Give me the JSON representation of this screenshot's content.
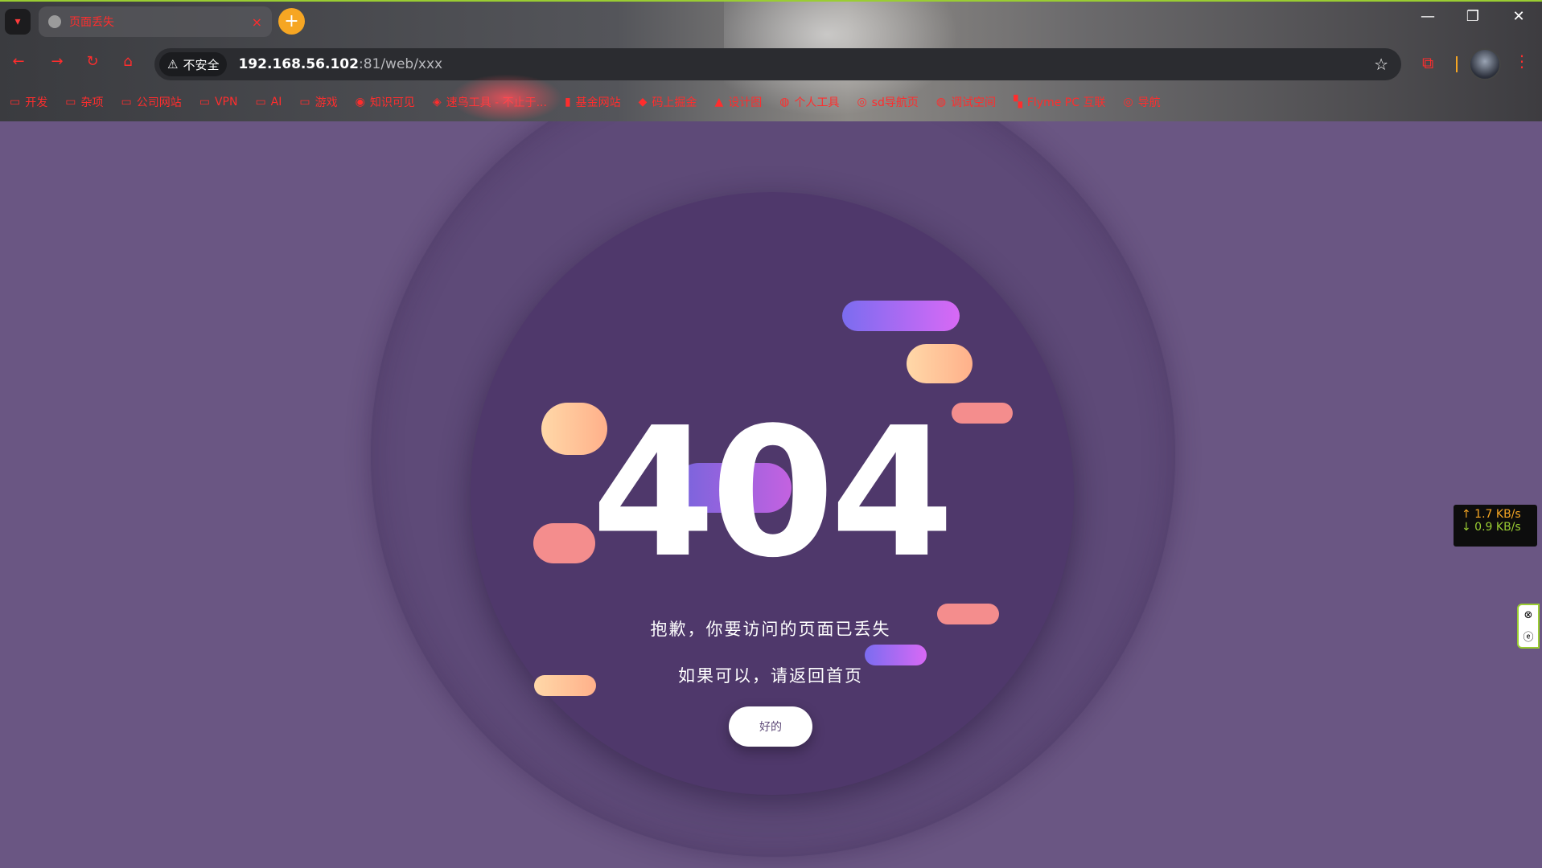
{
  "browser": {
    "tab": {
      "title": "页面丢失",
      "close_glyph": "×"
    },
    "new_tab_glyph": "+",
    "window_controls": {
      "minimize": "—",
      "restore": "❐",
      "close": "✕"
    },
    "nav": {
      "back": "←",
      "forward": "→",
      "reload": "↻",
      "home": "⌂"
    },
    "omnibox": {
      "security_label": "不安全",
      "warn_glyph": "⚠",
      "url_host": "192.168.56.102",
      "url_path": ":81/web/xxx"
    },
    "bookmarks": [
      {
        "icon": "folder-icon",
        "glyph": "▭",
        "label": "开发"
      },
      {
        "icon": "folder-icon",
        "glyph": "▭",
        "label": "杂项"
      },
      {
        "icon": "folder-icon",
        "glyph": "▭",
        "label": "公司网站"
      },
      {
        "icon": "folder-icon",
        "glyph": "▭",
        "label": "VPN"
      },
      {
        "icon": "folder-icon",
        "glyph": "▭",
        "label": "AI"
      },
      {
        "icon": "folder-icon",
        "glyph": "▭",
        "label": "游戏"
      },
      {
        "icon": "zhishi-icon",
        "glyph": "◉",
        "label": "知识可见"
      },
      {
        "icon": "cube-icon",
        "glyph": "◈",
        "label": "速鸟工具 - 不止于..."
      },
      {
        "icon": "fund-icon",
        "glyph": "▮",
        "label": "基金网站"
      },
      {
        "icon": "juejin-icon",
        "glyph": "◆",
        "label": "码上掘金"
      },
      {
        "icon": "design-icon",
        "glyph": "▲",
        "label": "设计图"
      },
      {
        "icon": "globe-icon",
        "glyph": "◍",
        "label": "个人工具"
      },
      {
        "icon": "swirl-icon",
        "glyph": "◎",
        "label": "sd导航页"
      },
      {
        "icon": "globe-icon",
        "glyph": "◍",
        "label": "调试空间"
      },
      {
        "icon": "flyme-icon",
        "glyph": "▚",
        "label": "Flyme PC 互联"
      },
      {
        "icon": "swirl-icon",
        "glyph": "◎",
        "label": "导航"
      }
    ]
  },
  "page": {
    "code": "404",
    "message_line1": "抱歉，你要访问的页面已丢失",
    "message_line2": "如果可以，请返回首页",
    "button_label": "好的"
  },
  "overlays": {
    "upload_speed": "↑ 1.7 KB/s",
    "download_speed": "↓ 0.9 KB/s"
  },
  "colors": {
    "page_bg": "#6a5683",
    "outer_ring": "#5e4a78",
    "inner_circle": "#4f386b",
    "accent_red": "#ff2d2d",
    "accent_orange": "#f6a623"
  }
}
